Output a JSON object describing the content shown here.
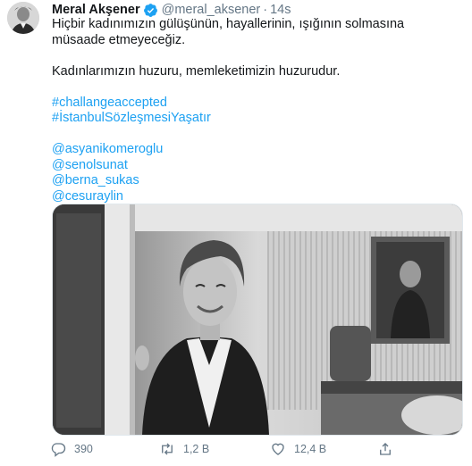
{
  "tweet": {
    "author_name": "Meral Akşener",
    "handle": "@meral_aksener",
    "separator": "·",
    "time": "14s",
    "text_line1": "Hiçbir kadınımızın gülüşünün, hayallerinin, ışığının solmasına müsaade etmeyeceğiz.",
    "text_line2": "Kadınlarımızın huzuru, memleketimizin huzurudur.",
    "hashtags": [
      "#challangeaccepted",
      "#İstanbulSözleşmesiYaşatır"
    ],
    "mentions": [
      "@asyanikomeroglu",
      "@senolsunat",
      "@berna_sukas",
      "@cesuraylin"
    ]
  },
  "actions": {
    "reply_count": "390",
    "retweet_count": "1,2 B",
    "like_count": "12,4 B",
    "share_label": ""
  },
  "icons": {
    "verified": "verified-badge-icon",
    "reply": "reply-icon",
    "retweet": "retweet-icon",
    "like": "heart-icon",
    "share": "share-icon"
  },
  "colors": {
    "link": "#1da1f2",
    "secondary_text": "#657786",
    "verified": "#1da1f2"
  }
}
